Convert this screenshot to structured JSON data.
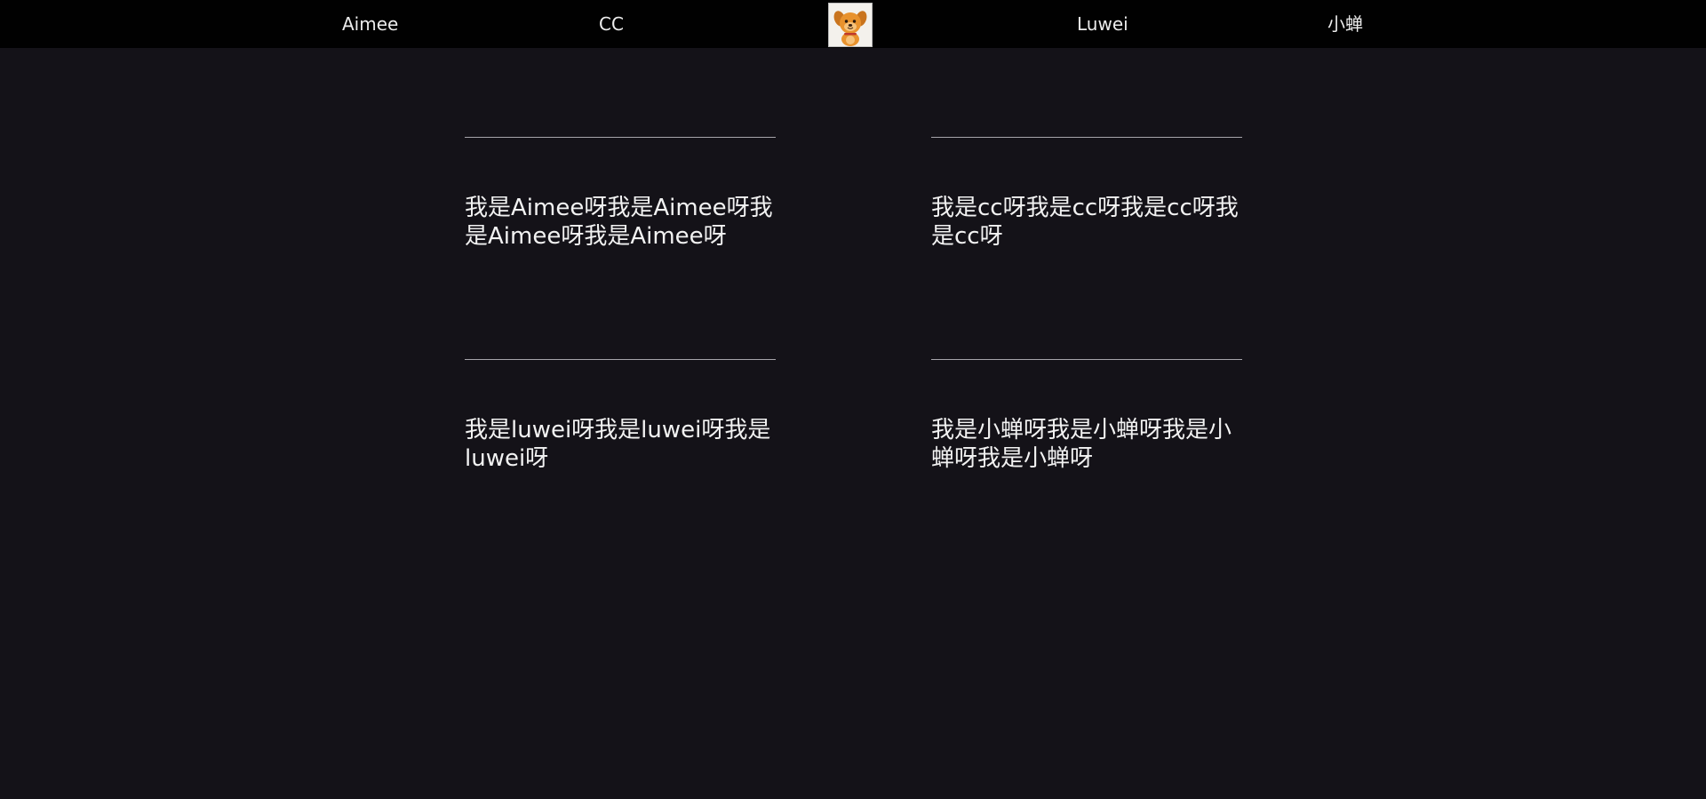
{
  "nav": {
    "items": [
      {
        "label": "Aimee"
      },
      {
        "label": "CC"
      },
      {
        "label": "Luwei"
      },
      {
        "label": "小蝉"
      }
    ],
    "logo_icon": "cartoon-dog-avatar-icon"
  },
  "cards": [
    {
      "text": "我是Aimee呀我是Aimee呀我是Aimee呀我是Aimee呀"
    },
    {
      "text": "我是cc呀我是cc呀我是cc呀我是cc呀"
    },
    {
      "text": "我是luwei呀我是luwei呀我是luwei呀"
    },
    {
      "text": "我是小蝉呀我是小蝉呀我是小蝉呀我是小蝉呀"
    }
  ],
  "colors": {
    "page_background": "#141218",
    "nav_background": "#010101",
    "divider": "#a6a4ab",
    "text": "#f2f2f2"
  }
}
